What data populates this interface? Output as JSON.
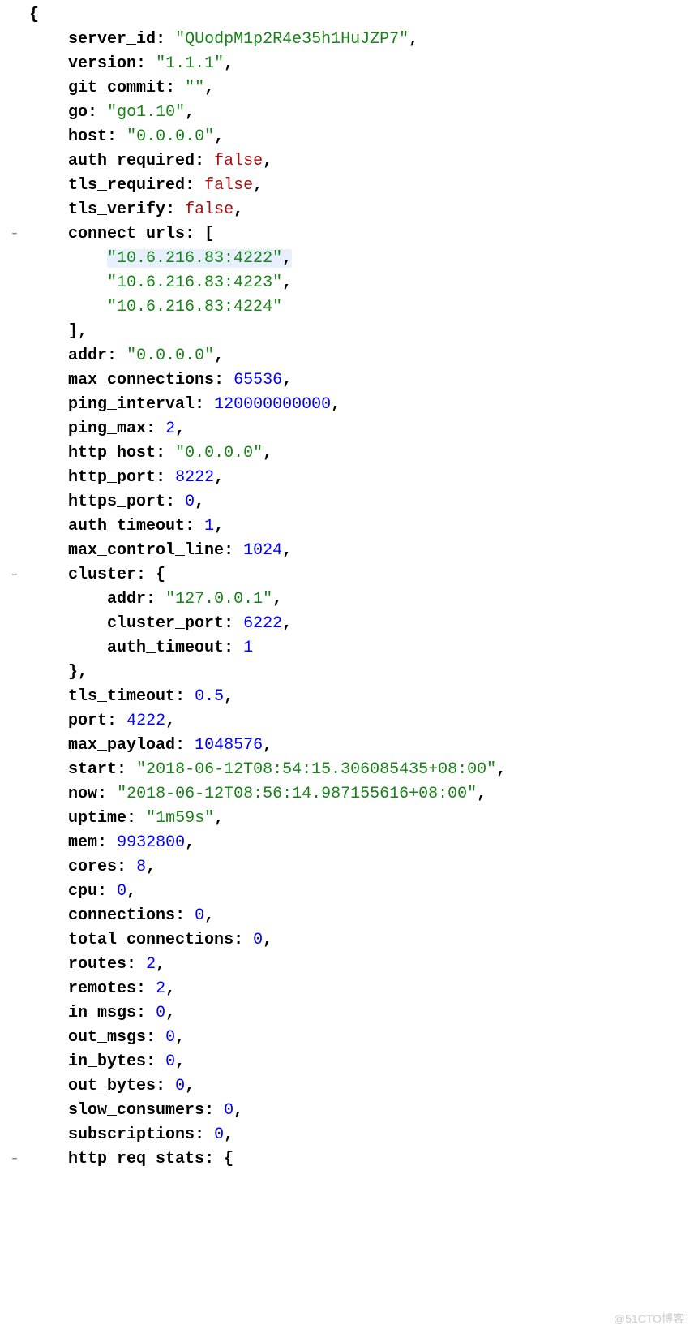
{
  "watermark": "@51CTO博客",
  "lines": [
    {
      "indent": 0,
      "toggle": "",
      "parts": [
        {
          "t": "punct",
          "v": "{"
        }
      ]
    },
    {
      "indent": 2,
      "toggle": "",
      "parts": [
        {
          "t": "key",
          "v": "server_id"
        },
        {
          "t": "punct",
          "v": ": "
        },
        {
          "t": "string",
          "v": "\"QUodpM1p2R4e35h1HuJZP7\""
        },
        {
          "t": "punct",
          "v": ","
        }
      ]
    },
    {
      "indent": 2,
      "toggle": "",
      "parts": [
        {
          "t": "key",
          "v": "version"
        },
        {
          "t": "punct",
          "v": ": "
        },
        {
          "t": "string",
          "v": "\"1.1.1\""
        },
        {
          "t": "punct",
          "v": ","
        }
      ]
    },
    {
      "indent": 2,
      "toggle": "",
      "parts": [
        {
          "t": "key",
          "v": "git_commit"
        },
        {
          "t": "punct",
          "v": ": "
        },
        {
          "t": "string",
          "v": "\"\""
        },
        {
          "t": "punct",
          "v": ","
        }
      ]
    },
    {
      "indent": 2,
      "toggle": "",
      "parts": [
        {
          "t": "key",
          "v": "go"
        },
        {
          "t": "punct",
          "v": ": "
        },
        {
          "t": "string",
          "v": "\"go1.10\""
        },
        {
          "t": "punct",
          "v": ","
        }
      ]
    },
    {
      "indent": 2,
      "toggle": "",
      "parts": [
        {
          "t": "key",
          "v": "host"
        },
        {
          "t": "punct",
          "v": ": "
        },
        {
          "t": "string",
          "v": "\"0.0.0.0\""
        },
        {
          "t": "punct",
          "v": ","
        }
      ]
    },
    {
      "indent": 2,
      "toggle": "",
      "parts": [
        {
          "t": "key",
          "v": "auth_required"
        },
        {
          "t": "punct",
          "v": ": "
        },
        {
          "t": "bool",
          "v": "false"
        },
        {
          "t": "punct",
          "v": ","
        }
      ]
    },
    {
      "indent": 2,
      "toggle": "",
      "parts": [
        {
          "t": "key",
          "v": "tls_required"
        },
        {
          "t": "punct",
          "v": ": "
        },
        {
          "t": "bool",
          "v": "false"
        },
        {
          "t": "punct",
          "v": ","
        }
      ]
    },
    {
      "indent": 2,
      "toggle": "",
      "parts": [
        {
          "t": "key",
          "v": "tls_verify"
        },
        {
          "t": "punct",
          "v": ": "
        },
        {
          "t": "bool",
          "v": "false"
        },
        {
          "t": "punct",
          "v": ","
        }
      ]
    },
    {
      "indent": 2,
      "toggle": "- ",
      "parts": [
        {
          "t": "key",
          "v": "connect_urls"
        },
        {
          "t": "punct",
          "v": ": ["
        }
      ]
    },
    {
      "indent": 4,
      "toggle": "",
      "highlight": true,
      "parts": [
        {
          "t": "string",
          "v": "\"10.6.216.83:4222\""
        },
        {
          "t": "punct",
          "v": ","
        }
      ]
    },
    {
      "indent": 4,
      "toggle": "",
      "parts": [
        {
          "t": "string",
          "v": "\"10.6.216.83:4223\""
        },
        {
          "t": "punct",
          "v": ","
        }
      ]
    },
    {
      "indent": 4,
      "toggle": "",
      "parts": [
        {
          "t": "string",
          "v": "\"10.6.216.83:4224\""
        }
      ]
    },
    {
      "indent": 2,
      "toggle": "",
      "parts": [
        {
          "t": "punct",
          "v": "],"
        }
      ]
    },
    {
      "indent": 2,
      "toggle": "",
      "parts": [
        {
          "t": "key",
          "v": "addr"
        },
        {
          "t": "punct",
          "v": ": "
        },
        {
          "t": "string",
          "v": "\"0.0.0.0\""
        },
        {
          "t": "punct",
          "v": ","
        }
      ]
    },
    {
      "indent": 2,
      "toggle": "",
      "parts": [
        {
          "t": "key",
          "v": "max_connections"
        },
        {
          "t": "punct",
          "v": ": "
        },
        {
          "t": "number",
          "v": "65536"
        },
        {
          "t": "punct",
          "v": ","
        }
      ]
    },
    {
      "indent": 2,
      "toggle": "",
      "parts": [
        {
          "t": "key",
          "v": "ping_interval"
        },
        {
          "t": "punct",
          "v": ": "
        },
        {
          "t": "number",
          "v": "120000000000"
        },
        {
          "t": "punct",
          "v": ","
        }
      ]
    },
    {
      "indent": 2,
      "toggle": "",
      "parts": [
        {
          "t": "key",
          "v": "ping_max"
        },
        {
          "t": "punct",
          "v": ": "
        },
        {
          "t": "number",
          "v": "2"
        },
        {
          "t": "punct",
          "v": ","
        }
      ]
    },
    {
      "indent": 2,
      "toggle": "",
      "parts": [
        {
          "t": "key",
          "v": "http_host"
        },
        {
          "t": "punct",
          "v": ": "
        },
        {
          "t": "string",
          "v": "\"0.0.0.0\""
        },
        {
          "t": "punct",
          "v": ","
        }
      ]
    },
    {
      "indent": 2,
      "toggle": "",
      "parts": [
        {
          "t": "key",
          "v": "http_port"
        },
        {
          "t": "punct",
          "v": ": "
        },
        {
          "t": "number",
          "v": "8222"
        },
        {
          "t": "punct",
          "v": ","
        }
      ]
    },
    {
      "indent": 2,
      "toggle": "",
      "parts": [
        {
          "t": "key",
          "v": "https_port"
        },
        {
          "t": "punct",
          "v": ": "
        },
        {
          "t": "number",
          "v": "0"
        },
        {
          "t": "punct",
          "v": ","
        }
      ]
    },
    {
      "indent": 2,
      "toggle": "",
      "parts": [
        {
          "t": "key",
          "v": "auth_timeout"
        },
        {
          "t": "punct",
          "v": ": "
        },
        {
          "t": "number",
          "v": "1"
        },
        {
          "t": "punct",
          "v": ","
        }
      ]
    },
    {
      "indent": 2,
      "toggle": "",
      "parts": [
        {
          "t": "key",
          "v": "max_control_line"
        },
        {
          "t": "punct",
          "v": ": "
        },
        {
          "t": "number",
          "v": "1024"
        },
        {
          "t": "punct",
          "v": ","
        }
      ]
    },
    {
      "indent": 2,
      "toggle": "- ",
      "parts": [
        {
          "t": "key",
          "v": "cluster"
        },
        {
          "t": "punct",
          "v": ": {"
        }
      ]
    },
    {
      "indent": 4,
      "toggle": "",
      "parts": [
        {
          "t": "key",
          "v": "addr"
        },
        {
          "t": "punct",
          "v": ": "
        },
        {
          "t": "string",
          "v": "\"127.0.0.1\""
        },
        {
          "t": "punct",
          "v": ","
        }
      ]
    },
    {
      "indent": 4,
      "toggle": "",
      "parts": [
        {
          "t": "key",
          "v": "cluster_port"
        },
        {
          "t": "punct",
          "v": ": "
        },
        {
          "t": "number",
          "v": "6222"
        },
        {
          "t": "punct",
          "v": ","
        }
      ]
    },
    {
      "indent": 4,
      "toggle": "",
      "parts": [
        {
          "t": "key",
          "v": "auth_timeout"
        },
        {
          "t": "punct",
          "v": ": "
        },
        {
          "t": "number",
          "v": "1"
        }
      ]
    },
    {
      "indent": 2,
      "toggle": "",
      "parts": [
        {
          "t": "punct",
          "v": "},"
        }
      ]
    },
    {
      "indent": 2,
      "toggle": "",
      "parts": [
        {
          "t": "key",
          "v": "tls_timeout"
        },
        {
          "t": "punct",
          "v": ": "
        },
        {
          "t": "number",
          "v": "0.5"
        },
        {
          "t": "punct",
          "v": ","
        }
      ]
    },
    {
      "indent": 2,
      "toggle": "",
      "parts": [
        {
          "t": "key",
          "v": "port"
        },
        {
          "t": "punct",
          "v": ": "
        },
        {
          "t": "number",
          "v": "4222"
        },
        {
          "t": "punct",
          "v": ","
        }
      ]
    },
    {
      "indent": 2,
      "toggle": "",
      "parts": [
        {
          "t": "key",
          "v": "max_payload"
        },
        {
          "t": "punct",
          "v": ": "
        },
        {
          "t": "number",
          "v": "1048576"
        },
        {
          "t": "punct",
          "v": ","
        }
      ]
    },
    {
      "indent": 2,
      "toggle": "",
      "parts": [
        {
          "t": "key",
          "v": "start"
        },
        {
          "t": "punct",
          "v": ": "
        },
        {
          "t": "string",
          "v": "\"2018-06-12T08:54:15.306085435+08:00\""
        },
        {
          "t": "punct",
          "v": ","
        }
      ]
    },
    {
      "indent": 2,
      "toggle": "",
      "parts": [
        {
          "t": "key",
          "v": "now"
        },
        {
          "t": "punct",
          "v": ": "
        },
        {
          "t": "string",
          "v": "\"2018-06-12T08:56:14.987155616+08:00\""
        },
        {
          "t": "punct",
          "v": ","
        }
      ]
    },
    {
      "indent": 2,
      "toggle": "",
      "parts": [
        {
          "t": "key",
          "v": "uptime"
        },
        {
          "t": "punct",
          "v": ": "
        },
        {
          "t": "string",
          "v": "\"1m59s\""
        },
        {
          "t": "punct",
          "v": ","
        }
      ]
    },
    {
      "indent": 2,
      "toggle": "",
      "parts": [
        {
          "t": "key",
          "v": "mem"
        },
        {
          "t": "punct",
          "v": ": "
        },
        {
          "t": "number",
          "v": "9932800"
        },
        {
          "t": "punct",
          "v": ","
        }
      ]
    },
    {
      "indent": 2,
      "toggle": "",
      "parts": [
        {
          "t": "key",
          "v": "cores"
        },
        {
          "t": "punct",
          "v": ": "
        },
        {
          "t": "number",
          "v": "8"
        },
        {
          "t": "punct",
          "v": ","
        }
      ]
    },
    {
      "indent": 2,
      "toggle": "",
      "parts": [
        {
          "t": "key",
          "v": "cpu"
        },
        {
          "t": "punct",
          "v": ": "
        },
        {
          "t": "number",
          "v": "0"
        },
        {
          "t": "punct",
          "v": ","
        }
      ]
    },
    {
      "indent": 2,
      "toggle": "",
      "parts": [
        {
          "t": "key",
          "v": "connections"
        },
        {
          "t": "punct",
          "v": ": "
        },
        {
          "t": "number",
          "v": "0"
        },
        {
          "t": "punct",
          "v": ","
        }
      ]
    },
    {
      "indent": 2,
      "toggle": "",
      "parts": [
        {
          "t": "key",
          "v": "total_connections"
        },
        {
          "t": "punct",
          "v": ": "
        },
        {
          "t": "number",
          "v": "0"
        },
        {
          "t": "punct",
          "v": ","
        }
      ]
    },
    {
      "indent": 2,
      "toggle": "",
      "parts": [
        {
          "t": "key",
          "v": "routes"
        },
        {
          "t": "punct",
          "v": ": "
        },
        {
          "t": "number",
          "v": "2"
        },
        {
          "t": "punct",
          "v": ","
        }
      ]
    },
    {
      "indent": 2,
      "toggle": "",
      "parts": [
        {
          "t": "key",
          "v": "remotes"
        },
        {
          "t": "punct",
          "v": ": "
        },
        {
          "t": "number",
          "v": "2"
        },
        {
          "t": "punct",
          "v": ","
        }
      ]
    },
    {
      "indent": 2,
      "toggle": "",
      "parts": [
        {
          "t": "key",
          "v": "in_msgs"
        },
        {
          "t": "punct",
          "v": ": "
        },
        {
          "t": "number",
          "v": "0"
        },
        {
          "t": "punct",
          "v": ","
        }
      ]
    },
    {
      "indent": 2,
      "toggle": "",
      "parts": [
        {
          "t": "key",
          "v": "out_msgs"
        },
        {
          "t": "punct",
          "v": ": "
        },
        {
          "t": "number",
          "v": "0"
        },
        {
          "t": "punct",
          "v": ","
        }
      ]
    },
    {
      "indent": 2,
      "toggle": "",
      "parts": [
        {
          "t": "key",
          "v": "in_bytes"
        },
        {
          "t": "punct",
          "v": ": "
        },
        {
          "t": "number",
          "v": "0"
        },
        {
          "t": "punct",
          "v": ","
        }
      ]
    },
    {
      "indent": 2,
      "toggle": "",
      "parts": [
        {
          "t": "key",
          "v": "out_bytes"
        },
        {
          "t": "punct",
          "v": ": "
        },
        {
          "t": "number",
          "v": "0"
        },
        {
          "t": "punct",
          "v": ","
        }
      ]
    },
    {
      "indent": 2,
      "toggle": "",
      "parts": [
        {
          "t": "key",
          "v": "slow_consumers"
        },
        {
          "t": "punct",
          "v": ": "
        },
        {
          "t": "number",
          "v": "0"
        },
        {
          "t": "punct",
          "v": ","
        }
      ]
    },
    {
      "indent": 2,
      "toggle": "",
      "parts": [
        {
          "t": "key",
          "v": "subscriptions"
        },
        {
          "t": "punct",
          "v": ": "
        },
        {
          "t": "number",
          "v": "0"
        },
        {
          "t": "punct",
          "v": ","
        }
      ]
    },
    {
      "indent": 2,
      "toggle": "- ",
      "parts": [
        {
          "t": "key",
          "v": "http_req_stats"
        },
        {
          "t": "punct",
          "v": ": {"
        }
      ]
    }
  ]
}
